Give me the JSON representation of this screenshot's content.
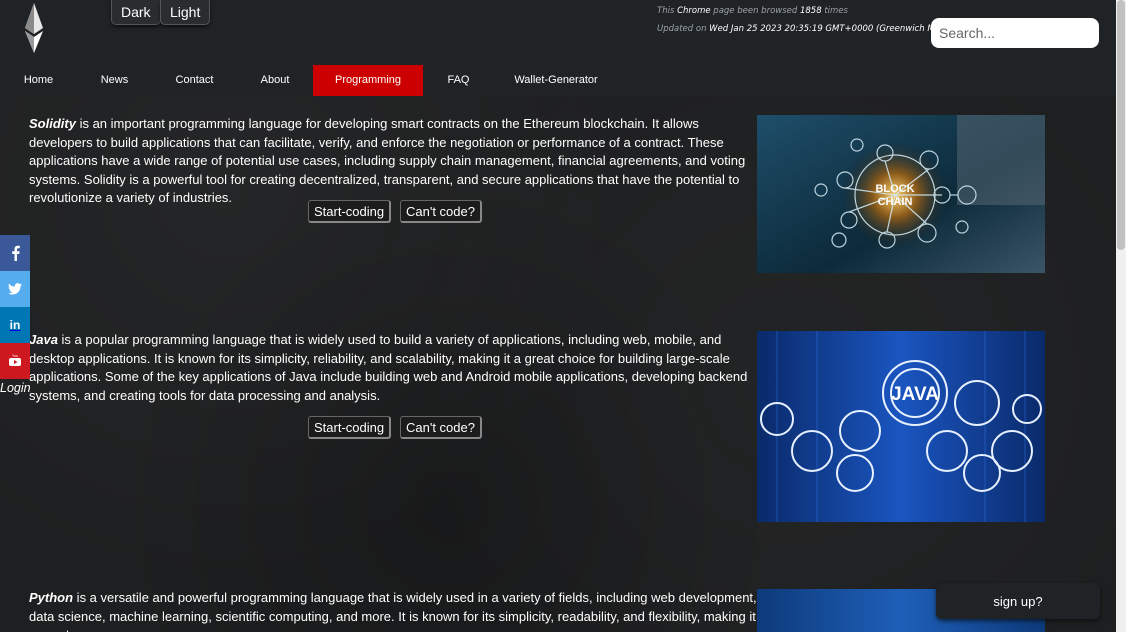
{
  "header": {
    "dark_label": "Dark",
    "light_label": "Light",
    "browsed_prefix": "This ",
    "browser_name": "Chrome",
    "browsed_mid": " page been browsed ",
    "browse_count": "1858",
    "browsed_suffix": " times",
    "updated_prefix": "Updated on ",
    "updated_date": "Wed Jan 25 2023 20:35:19 GMT+0000 (Greenwich Mean",
    "search_placeholder": "Search..."
  },
  "nav": {
    "items": [
      {
        "label": "Home"
      },
      {
        "label": "News"
      },
      {
        "label": "Contact"
      },
      {
        "label": "About"
      },
      {
        "label": "Programming"
      },
      {
        "label": "FAQ"
      },
      {
        "label": "Wallet-Generator"
      }
    ],
    "active_color": "#cc0000"
  },
  "sections": [
    {
      "lang": "Solidity",
      "text": " is an important programming language for developing smart contracts on the Ethereum blockchain. It allows developers to build applications that can facilitate, verify, and enforce the negotiation or performance of a contract. These applications have a wide range of potential use cases, including supply chain management, financial agreements, and voting systems. Solidity is a powerful tool for creating decentralized, transparent, and secure applications that have the potential to revolutionize a variety of industries.",
      "start_label": "Start-coding",
      "cant_label": "Can't code?",
      "image_word1": "BLOCK",
      "image_word2": "CHAIN"
    },
    {
      "lang": "Java",
      "text": " is a popular programming language that is widely used to build a variety of applications, including web, mobile, and desktop applications. It is known for its simplicity, reliability, and scalability, making it a great choice for building large-scale applications. Some of the key applications of Java include building web and Android mobile applications, developing backend systems, and creating tools for data processing and analysis.",
      "start_label": "Start-coding",
      "cant_label": "Can't code?",
      "image_word1": "JAVA"
    },
    {
      "lang": "Python",
      "text": " is a versatile and powerful programming language that is widely used in a variety of fields, including web development, data science, machine learning, scientific computing, and more. It is known for its simplicity, readability, and flexibility, making it a great"
    }
  ],
  "social": [
    {
      "icon": "facebook-icon",
      "glyph": "f",
      "color": "#3b5998"
    },
    {
      "icon": "twitter-icon",
      "glyph": "🐦",
      "color": "#55acee"
    },
    {
      "icon": "linkedin-icon",
      "glyph": "in",
      "color": "#0077b5"
    },
    {
      "icon": "youtube-icon",
      "glyph": "▶",
      "color": "#cc181e"
    }
  ],
  "login_label": "Login",
  "signup_label": "sign up?"
}
